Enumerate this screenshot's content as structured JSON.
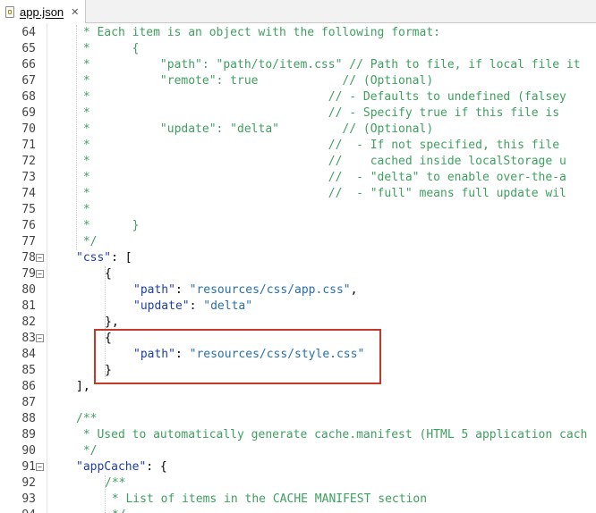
{
  "tab": {
    "label": "app.json",
    "close": "✕",
    "icon": "json-file-icon"
  },
  "accent": {
    "highlight_border": "#c0392b",
    "comment": "#3f9f5f",
    "key": "#1f3fa0",
    "string": "#2a6fa8"
  },
  "lines": [
    {
      "n": "64",
      "fold": "",
      "code": " * Each item is an object with the following format:",
      "kind": "comment"
    },
    {
      "n": "65",
      "fold": "",
      "code": " *      {",
      "kind": "comment"
    },
    {
      "n": "66",
      "fold": "",
      "code": " *          \"path\": \"path/to/item.css\" // Path to file, if local file it",
      "kind": "comment"
    },
    {
      "n": "67",
      "fold": "",
      "code": " *          \"remote\": true            // (Optional)",
      "kind": "comment"
    },
    {
      "n": "68",
      "fold": "",
      "code": " *                                  // - Defaults to undefined (falsey",
      "kind": "comment"
    },
    {
      "n": "69",
      "fold": "",
      "code": " *                                  // - Specify true if this file is",
      "kind": "comment"
    },
    {
      "n": "70",
      "fold": "",
      "code": " *          \"update\": \"delta\"         // (Optional)",
      "kind": "comment"
    },
    {
      "n": "71",
      "fold": "",
      "code": " *                                  //  - If not specified, this file",
      "kind": "comment"
    },
    {
      "n": "72",
      "fold": "",
      "code": " *                                  //    cached inside localStorage u",
      "kind": "comment"
    },
    {
      "n": "73",
      "fold": "",
      "code": " *                                  //  - \"delta\" to enable over-the-a",
      "kind": "comment"
    },
    {
      "n": "74",
      "fold": "",
      "code": " *                                  //  - \"full\" means full update wil",
      "kind": "comment"
    },
    {
      "n": "75",
      "fold": "",
      "code": " *",
      "kind": "comment"
    },
    {
      "n": "76",
      "fold": "",
      "code": " *      }",
      "kind": "comment"
    },
    {
      "n": "77",
      "fold": "",
      "code": " */",
      "kind": "comment"
    },
    {
      "n": "78",
      "fold": "−",
      "code": "",
      "kind": "code",
      "tokens": [
        {
          "t": "\"css\"",
          "c": "key"
        },
        {
          "t": ": [",
          "c": "punct"
        }
      ]
    },
    {
      "n": "79",
      "fold": "−",
      "code": "",
      "kind": "code",
      "indent": 1,
      "tokens": [
        {
          "t": "{",
          "c": "punct"
        }
      ]
    },
    {
      "n": "80",
      "fold": "",
      "code": "",
      "kind": "code",
      "indent": 2,
      "tokens": [
        {
          "t": "\"path\"",
          "c": "key"
        },
        {
          "t": ": ",
          "c": "punct"
        },
        {
          "t": "\"resources/css/app.css\"",
          "c": "str"
        },
        {
          "t": ",",
          "c": "punct"
        }
      ]
    },
    {
      "n": "81",
      "fold": "",
      "code": "",
      "kind": "code",
      "indent": 2,
      "tokens": [
        {
          "t": "\"update\"",
          "c": "key"
        },
        {
          "t": ": ",
          "c": "punct"
        },
        {
          "t": "\"delta\"",
          "c": "str"
        }
      ]
    },
    {
      "n": "82",
      "fold": "",
      "code": "",
      "kind": "code",
      "indent": 1,
      "tokens": [
        {
          "t": "},",
          "c": "punct"
        }
      ]
    },
    {
      "n": "83",
      "fold": "−",
      "code": "",
      "kind": "code",
      "indent": 1,
      "tokens": [
        {
          "t": "{",
          "c": "punct"
        }
      ]
    },
    {
      "n": "84",
      "fold": "",
      "code": "",
      "kind": "code",
      "indent": 2,
      "tokens": [
        {
          "t": "\"path\"",
          "c": "key"
        },
        {
          "t": ": ",
          "c": "punct"
        },
        {
          "t": "\"resources/css/style.css\"",
          "c": "str"
        }
      ]
    },
    {
      "n": "85",
      "fold": "",
      "code": "",
      "kind": "code",
      "indent": 1,
      "tokens": [
        {
          "t": "}",
          "c": "punct"
        }
      ]
    },
    {
      "n": "86",
      "fold": "",
      "code": "",
      "kind": "code",
      "tokens": [
        {
          "t": "],",
          "c": "punct"
        }
      ]
    },
    {
      "n": "87",
      "fold": "",
      "code": "",
      "kind": "code",
      "tokens": []
    },
    {
      "n": "88",
      "fold": "",
      "code": "/**",
      "kind": "comment"
    },
    {
      "n": "89",
      "fold": "",
      "code": " * Used to automatically generate cache.manifest (HTML 5 application cach",
      "kind": "comment"
    },
    {
      "n": "90",
      "fold": "",
      "code": " */",
      "kind": "comment"
    },
    {
      "n": "91",
      "fold": "−",
      "code": "",
      "kind": "code",
      "tokens": [
        {
          "t": "\"appCache\"",
          "c": "key"
        },
        {
          "t": ": {",
          "c": "punct"
        }
      ]
    },
    {
      "n": "92",
      "fold": "",
      "code": "/**",
      "kind": "comment",
      "indent": 1
    },
    {
      "n": "93",
      "fold": "",
      "code": " * List of items in the CACHE MANIFEST section",
      "kind": "comment",
      "indent": 1
    },
    {
      "n": "94",
      "fold": "",
      "code": " */",
      "kind": "comment",
      "indent": 1
    }
  ]
}
